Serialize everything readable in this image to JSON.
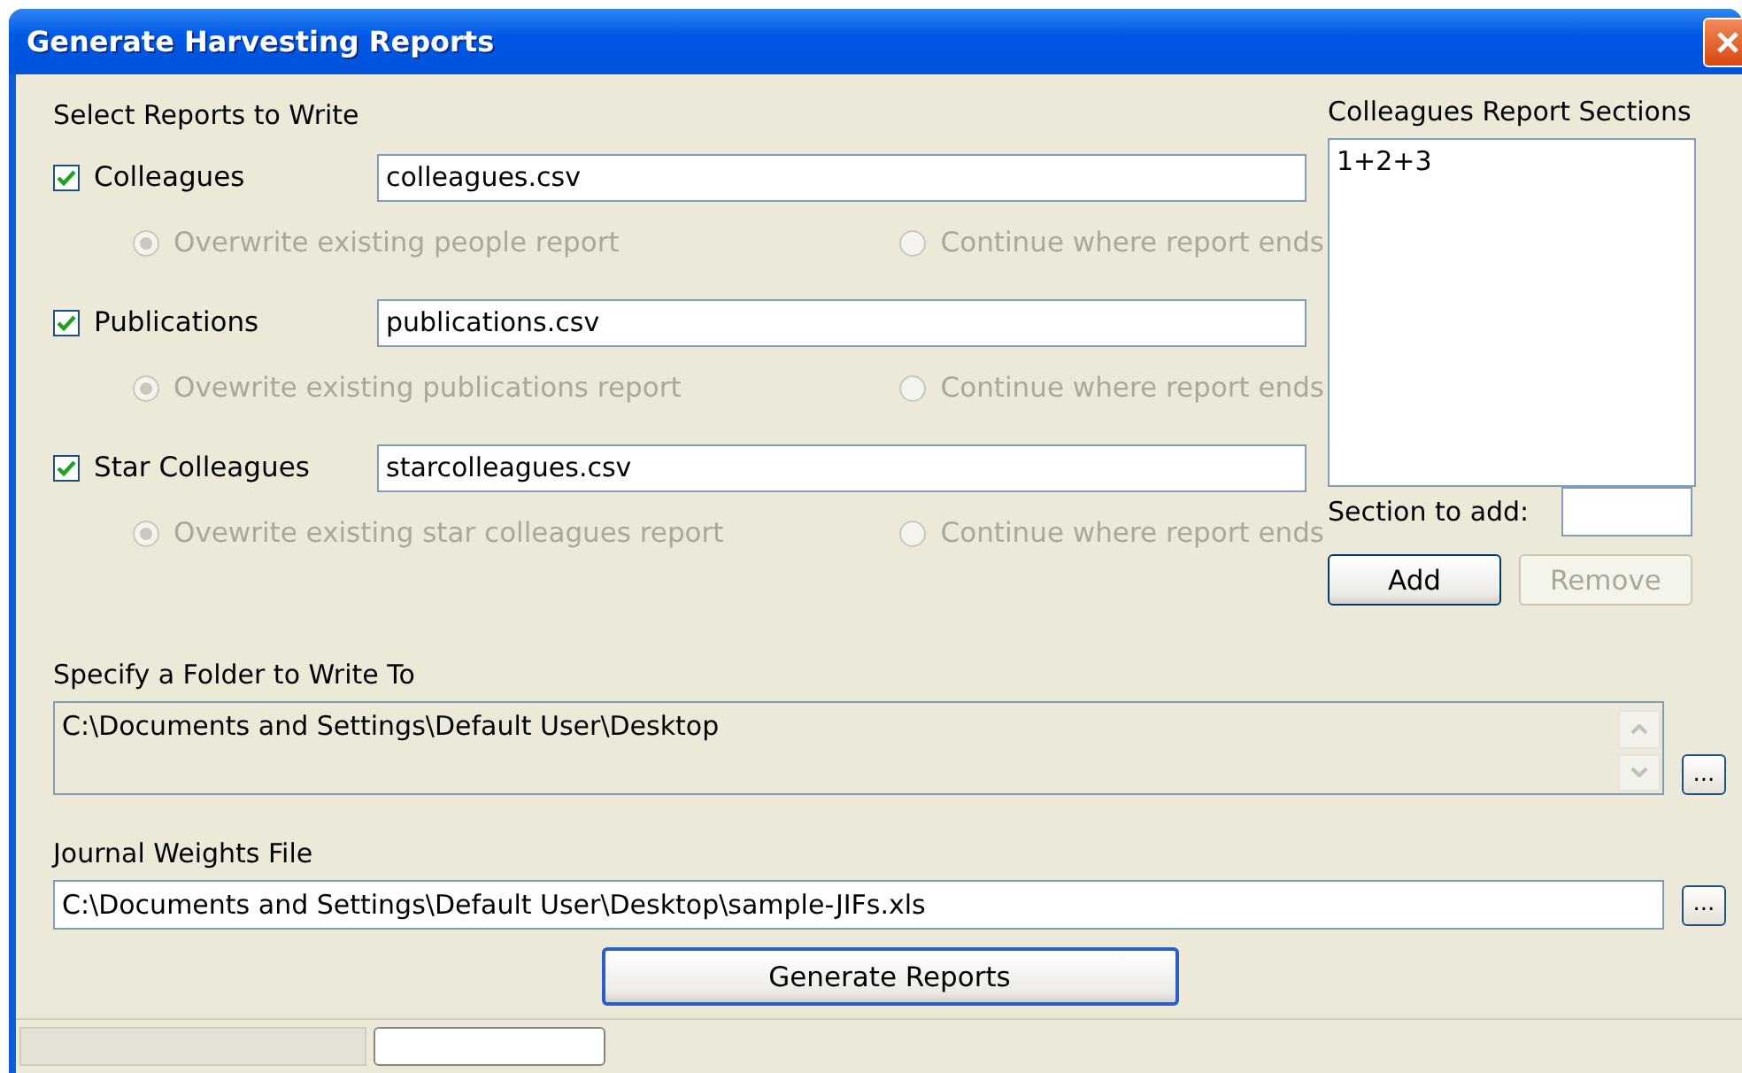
{
  "window": {
    "title": "Generate Harvesting Reports"
  },
  "select_label": "Select Reports to Write",
  "reports": [
    {
      "label": "Colleagues",
      "checked": true,
      "file": "colleagues.csv",
      "options": [
        {
          "label": "Overwrite existing people report",
          "selected": true,
          "disabled": true
        },
        {
          "label": "Continue where report ends",
          "selected": false,
          "disabled": true
        }
      ]
    },
    {
      "label": "Publications",
      "checked": true,
      "file": "publications.csv",
      "options": [
        {
          "label": "Ovewrite existing publications report",
          "selected": true,
          "disabled": true
        },
        {
          "label": "Continue where report ends",
          "selected": false,
          "disabled": true
        }
      ]
    },
    {
      "label": "Star Colleagues",
      "checked": true,
      "file": "starcolleagues.csv",
      "options": [
        {
          "label": "Ovewrite existing star colleagues report",
          "selected": true,
          "disabled": true
        },
        {
          "label": "Continue where report ends",
          "selected": false,
          "disabled": true
        }
      ]
    }
  ],
  "sections": {
    "label": "Colleagues Report Sections",
    "items": [
      "1+2+3"
    ],
    "add_label": "Section to add:",
    "buttons": [
      {
        "label": "Add",
        "disabled": false
      },
      {
        "label": "Remove",
        "disabled": true
      }
    ]
  },
  "folder": {
    "label": "Specify a Folder to Write To",
    "value": "C:\\Documents and Settings\\Default User\\Desktop",
    "disabled": true,
    "browse": "..."
  },
  "journal": {
    "label": "Journal Weights File",
    "value": "C:\\Documents and Settings\\Default User\\Desktop\\sample-JIFs.xls",
    "browse": "..."
  },
  "generate_button": "Generate Reports"
}
